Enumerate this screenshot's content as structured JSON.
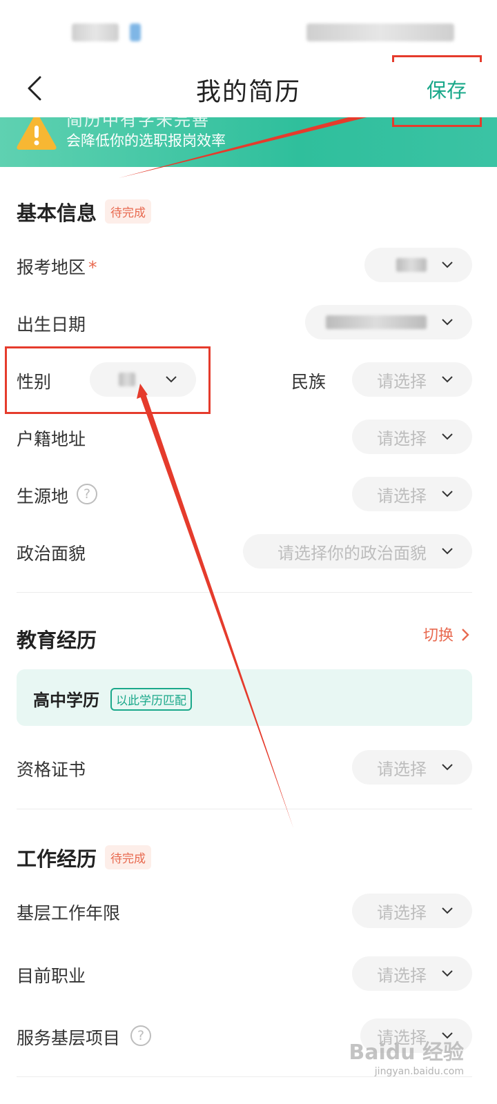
{
  "header": {
    "title": "我的简历",
    "save_label": "保存"
  },
  "banner": {
    "partial_text": "简历中有字未完善",
    "text": "会降低你的选职报岗效率"
  },
  "basic": {
    "title": "基本信息",
    "tag": "待完成",
    "region": {
      "label": "报考地区",
      "required": "*"
    },
    "birth": {
      "label": "出生日期"
    },
    "gender": {
      "label": "性别"
    },
    "ethnic": {
      "label": "民族",
      "placeholder": "请选择"
    },
    "hukou": {
      "label": "户籍地址",
      "placeholder": "请选择"
    },
    "origin": {
      "label": "生源地",
      "help": "?",
      "placeholder": "请选择"
    },
    "politics": {
      "label": "政治面貌",
      "placeholder": "请选择你的政治面貌"
    }
  },
  "education": {
    "title": "教育经历",
    "switch_label": "切换",
    "card_title": "高中学历",
    "card_tag": "以此学历匹配",
    "cert": {
      "label": "资格证书",
      "placeholder": "请选择"
    }
  },
  "work": {
    "title": "工作经历",
    "tag": "待完成",
    "years": {
      "label": "基层工作年限",
      "placeholder": "请选择"
    },
    "job": {
      "label": "目前职业",
      "placeholder": "请选择"
    },
    "service": {
      "label": "服务基层项目",
      "help": "?",
      "placeholder": "请选择"
    }
  },
  "watermark": {
    "brand": "Baidu 经验",
    "url": "jingyan.baidu.com"
  },
  "colors": {
    "accent": "#1aa88a",
    "warning": "#e8694f",
    "annotation": "#e53b2c"
  }
}
